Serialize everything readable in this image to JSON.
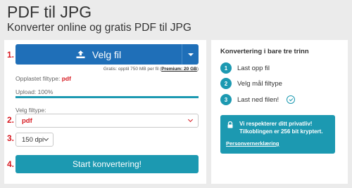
{
  "header": {
    "title": "PDF til JPG",
    "subtitle": "Konverter online og gratis PDF til JPG"
  },
  "converter": {
    "step_markers": [
      "1.",
      "2.",
      "3.",
      "4."
    ],
    "upload_button_label": "Velg fil",
    "limit_prefix": "Gratis: opptil 750 MB per fil (",
    "limit_premium": "Premium: 20 GB",
    "limit_suffix": ")",
    "uploaded_label": "Opplastet filtype:",
    "uploaded_type": "pdf",
    "progress_label": "Upload: 100%",
    "progress_fraction": 1.0,
    "select_label": "Velg filtype:",
    "format_value": "pdf",
    "dpi_value": "150 dpi",
    "start_button_label": "Start konvertering!"
  },
  "sidebar": {
    "title": "Konvertering i bare tre trinn",
    "steps": [
      {
        "num": "1",
        "label": "Last opp fil"
      },
      {
        "num": "2",
        "label": "Velg mål filtype"
      },
      {
        "num": "3",
        "label": "Last ned filen!"
      }
    ],
    "privacy_text": "Vi respekterer ditt privatliv! Tilkoblingen er 256 bit kryptert.",
    "privacy_link": "Personvernerklæring"
  },
  "colors": {
    "primary_blue": "#1f6fb8",
    "teal": "#1c99b1",
    "red_marker": "#d71920",
    "background": "#ebebeb"
  },
  "icons": {
    "upload": "upload-icon",
    "dropdown": "caret-down-icon",
    "lock": "lock-icon",
    "check": "check-circle-icon"
  }
}
